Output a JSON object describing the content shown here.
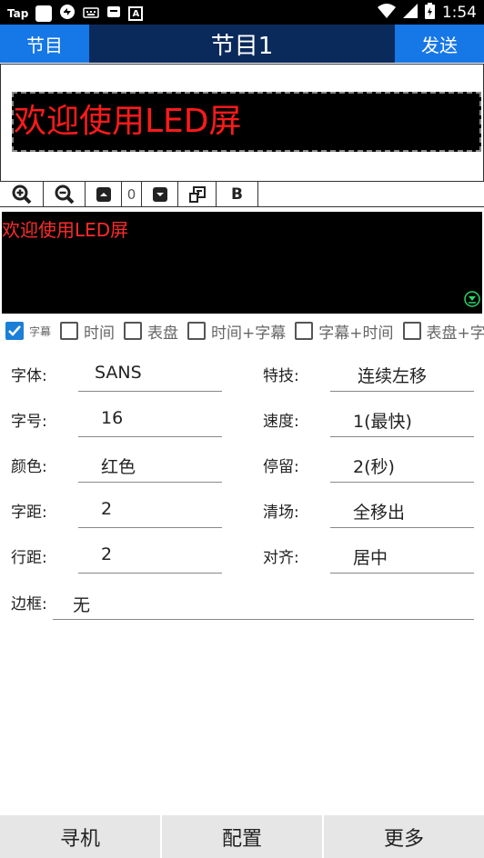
{
  "status_bar": {
    "carrier": "Tap",
    "time": "1:54",
    "box_glyph": "A"
  },
  "header": {
    "left_button": "节目",
    "title": "节目1",
    "right_button": "发送"
  },
  "preview": {
    "text": "欢迎使用LED屏"
  },
  "toolbar": {
    "counter": "0",
    "bold_label": "B"
  },
  "editor": {
    "text": "欢迎使用LED屏"
  },
  "content_types": [
    {
      "label": "字幕",
      "checked": true
    },
    {
      "label": "时间",
      "checked": false
    },
    {
      "label": "表盘",
      "checked": false
    },
    {
      "label": "时间+字幕",
      "checked": false
    },
    {
      "label": "字幕+时间",
      "checked": false
    },
    {
      "label": "表盘+字",
      "checked": false
    }
  ],
  "settings": {
    "font_label": "字体:",
    "font_value": "SANS",
    "size_label": "字号:",
    "size_value": "16",
    "color_label": "颜色:",
    "color_value": "红色",
    "spacing_label": "字距:",
    "spacing_value": "2",
    "line_label": "行距:",
    "line_value": "2",
    "effect_label": "特技:",
    "effect_value": "连续左移",
    "speed_label": "速度:",
    "speed_value": "1(最快)",
    "stay_label": "停留:",
    "stay_value": "2(秒)",
    "clear_label": "清场:",
    "clear_value": "全移出",
    "align_label": "对齐:",
    "align_value": "居中",
    "border_label": "边框:",
    "border_value": "无"
  },
  "bottom_nav": {
    "search": "寻机",
    "config": "配置",
    "more": "更多"
  },
  "colors": {
    "title_bg": "#0a2a5c",
    "title_button": "#1677e6",
    "led_text": "#ff1a1a",
    "checkbox": "#1a7fd6"
  }
}
